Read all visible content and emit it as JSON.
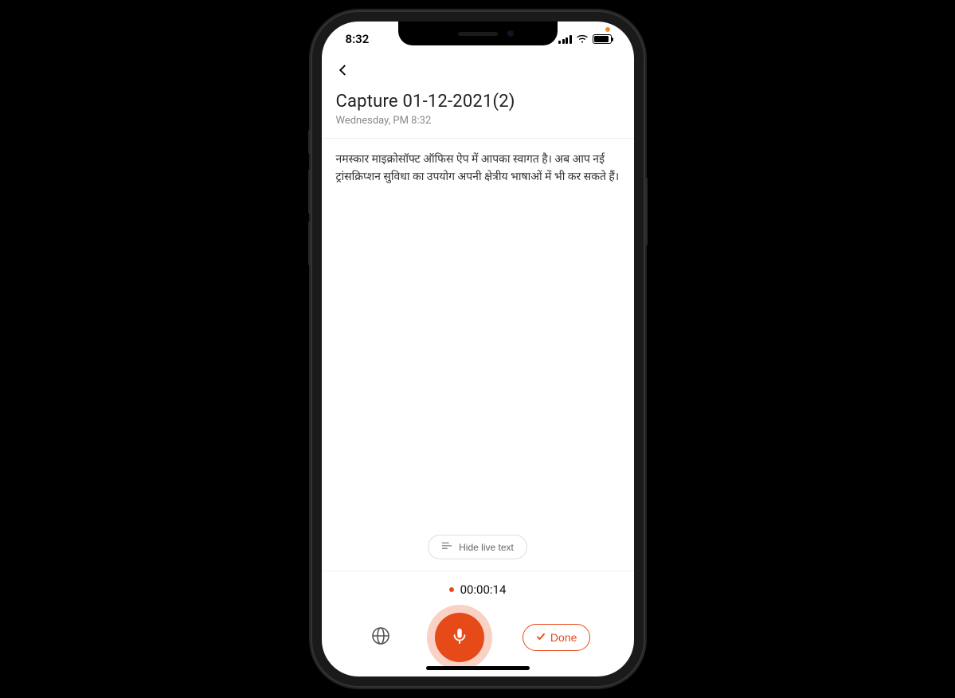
{
  "status": {
    "time": "8:32"
  },
  "header": {
    "title": "Capture 01-12-2021(2)",
    "subtitle": "Wednesday, PM 8:32"
  },
  "transcript": {
    "text": "नमस्कार माइक्रोसॉफ्ट ऑफिस ऐप में आपका स्वागत है। अब आप नई ट्रांसक्रिप्शन सुविधा का उपयोग अपनी क्षेत्रीय भाषाओं में भी कर सकते हैं।"
  },
  "controls": {
    "hide_live_text_label": "Hide live text",
    "timer": "00:00:14",
    "done_label": "Done"
  },
  "colors": {
    "accent": "#e64a19"
  }
}
